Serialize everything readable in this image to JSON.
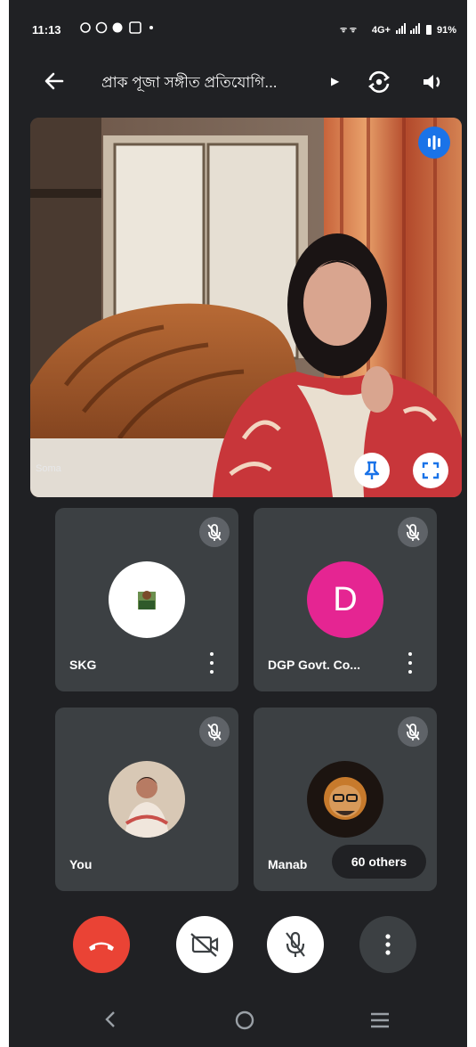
{
  "status_bar": {
    "time": "11:13",
    "battery": "91%",
    "network": "4G+"
  },
  "app_bar": {
    "title": "প্রাক পূজা সঙ্গীত প্রতিযোগি..."
  },
  "main_video": {
    "name_tag": "Soma"
  },
  "participants": [
    {
      "name": "SKG",
      "avatar_type": "photo"
    },
    {
      "name": "DGP Govt. Co...",
      "avatar_type": "letter",
      "avatar_letter": "D",
      "avatar_color": "#e52592"
    },
    {
      "name": "You",
      "avatar_type": "photo"
    },
    {
      "name": "Manab",
      "avatar_type": "photo"
    }
  ],
  "others_pill": "60 others",
  "controls": [
    "end-call",
    "camera-off",
    "mic-off",
    "more-options"
  ],
  "colors": {
    "background": "#202124",
    "tile": "#3c4043",
    "end_call": "#ea4335",
    "accent": "#1a73e8"
  }
}
